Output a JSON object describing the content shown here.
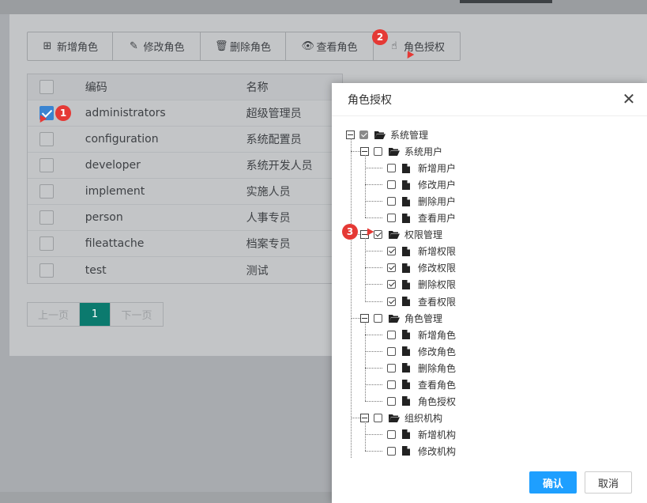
{
  "toolbar": {
    "add_label": "新增角色",
    "edit_label": "修改角色",
    "delete_label": "删除角色",
    "view_label": "查看角色",
    "auth_label": "角色授权"
  },
  "table": {
    "headers": {
      "code": "编码",
      "name": "名称"
    },
    "rows": [
      {
        "code": "administrators",
        "name": "超级管理员",
        "checked": true
      },
      {
        "code": "configuration",
        "name": "系统配置员",
        "checked": false
      },
      {
        "code": "developer",
        "name": "系统开发人员",
        "checked": false
      },
      {
        "code": "implement",
        "name": "实施人员",
        "checked": false
      },
      {
        "code": "person",
        "name": "人事专员",
        "checked": false
      },
      {
        "code": "fileattache",
        "name": "档案专员",
        "checked": false
      },
      {
        "code": "test",
        "name": "测试",
        "checked": false
      }
    ]
  },
  "pager": {
    "prev": "上一页",
    "page": "1",
    "next": "下一页"
  },
  "badges": [
    "1",
    "2",
    "3"
  ],
  "dialog": {
    "title": "角色授权",
    "confirm": "确认",
    "cancel": "取消",
    "tree": {
      "root": "系统管理",
      "groups": [
        {
          "label": "系统用户",
          "checked": false,
          "items": [
            {
              "label": "新增用户",
              "checked": false
            },
            {
              "label": "修改用户",
              "checked": false
            },
            {
              "label": "删除用户",
              "checked": false
            },
            {
              "label": "查看用户",
              "checked": false
            }
          ]
        },
        {
          "label": "权限管理",
          "checked": true,
          "items": [
            {
              "label": "新增权限",
              "checked": true
            },
            {
              "label": "修改权限",
              "checked": true
            },
            {
              "label": "删除权限",
              "checked": true
            },
            {
              "label": "查看权限",
              "checked": true
            }
          ]
        },
        {
          "label": "角色管理",
          "checked": false,
          "items": [
            {
              "label": "新增角色",
              "checked": false
            },
            {
              "label": "修改角色",
              "checked": false
            },
            {
              "label": "删除角色",
              "checked": false
            },
            {
              "label": "查看角色",
              "checked": false
            },
            {
              "label": "角色授权",
              "checked": false
            }
          ]
        },
        {
          "label": "组织机构",
          "checked": false,
          "items": [
            {
              "label": "新增机构",
              "checked": false
            },
            {
              "label": "修改机构",
              "checked": false
            }
          ]
        }
      ]
    }
  },
  "colors": {
    "primary": "#1e9fff",
    "page_active": "#0b7a6e",
    "badge": "#e53935",
    "checkbox_checked": "#3a84d1"
  }
}
